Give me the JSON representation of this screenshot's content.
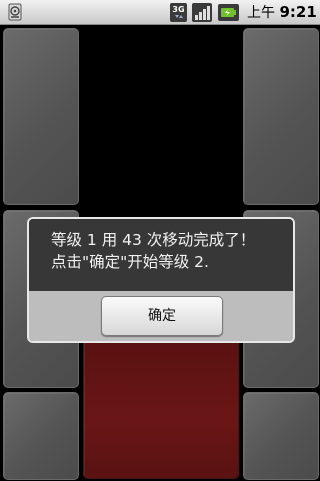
{
  "status_bar": {
    "network_label": "3G",
    "time_prefix": "上午",
    "time": "9:21",
    "icons": [
      "sd-card-icon",
      "3g-icon",
      "signal-icon",
      "battery-charging-icon"
    ]
  },
  "game": {
    "tile_color": "#5c5c5c",
    "target_color": "#621414"
  },
  "dialog": {
    "message_line1": "等级 1 用 43 次移动完成了！",
    "message_line2": "点击\"确定\"开始等级 2.",
    "ok_label": "确定"
  }
}
